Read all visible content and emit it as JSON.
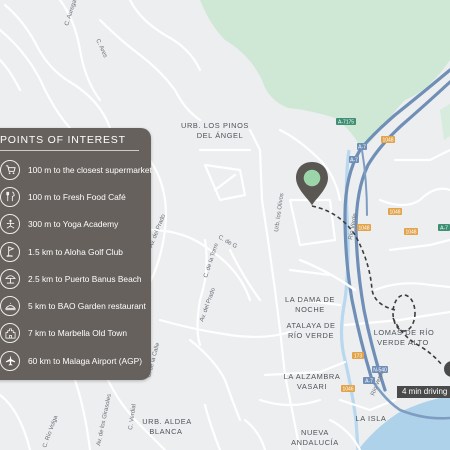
{
  "map": {
    "colors": {
      "land": "#eceef0",
      "park": "#cfe8d6",
      "water": "#aed2ea",
      "highway": "#6f8fb6",
      "accent": "#3e8f73",
      "panel": "#605b56"
    },
    "area_labels": {
      "pinos_1": "URB. LOS PINOS",
      "pinos_2": "DEL ÁNGEL",
      "dama_1": "LA DAMA DE",
      "dama_2": "NOCHE",
      "atalaya_1": "ATALAYA DE",
      "atalaya_2": "RÍO VERDE",
      "lomas_1": "LOMAS DE RÍO",
      "lomas_2": "VERDE ALTO",
      "alzambra_1": "LA ALZAMBRA",
      "alzambra_2": "VASARI",
      "aldea_1": "URB. ALDEA",
      "aldea_2": "BLANCA",
      "isla": "LA ISLA",
      "nueva_1": "NUEVA",
      "nueva_2": "ANDALUCÍA"
    },
    "street_labels": {
      "aurega": "C. Aurega",
      "ares": "C. Ares",
      "prado1": "Av. del Prado",
      "prado2": "Av. del Prado",
      "urb_olivos": "Urb. los Olivos",
      "rio_verde1": "Río Verde",
      "rio_verde2": "Río Verde",
      "de_la_torre": "C. de la Torre",
      "calle_g": "C. de G",
      "calle_calle": "C. de la Calle",
      "girasoles": "Av. de los Girasoles",
      "verdial": "C. Verdial",
      "rio_volga": "C. Río Volga"
    },
    "road_shields": {
      "a7175": "A-7175",
      "n1048a": "1048",
      "a7_1": "A-7",
      "a7_2": "A-7",
      "n1048b": "1048",
      "n1048c": "1048",
      "n1048d": "1048",
      "a7e": "A-7",
      "n173": "173",
      "a7_3": "A-7",
      "n1046": "1046",
      "n540": "N-540"
    },
    "drive_badge": "4 min driving"
  },
  "poi_panel": {
    "title": "POINTS OF INTEREST",
    "items": [
      {
        "label": "100 m to the closest supermarket",
        "icon": "shopping-cart-icon"
      },
      {
        "label": "100 m to Fresh Food Café",
        "icon": "cutlery-icon"
      },
      {
        "label": "300 m to Yoga Academy",
        "icon": "yoga-icon"
      },
      {
        "label": "1.5 km to Aloha Golf Club",
        "icon": "golf-flag-icon"
      },
      {
        "label": "2.5 km to Puerto Banus Beach",
        "icon": "beach-umbrella-icon"
      },
      {
        "label": "5 km to BAO Garden restaurant",
        "icon": "restaurant-icon"
      },
      {
        "label": "7 km to Marbella Old Town",
        "icon": "old-town-icon"
      },
      {
        "label": "60 km to Malaga Airport (AGP)",
        "icon": "airplane-icon"
      }
    ]
  }
}
